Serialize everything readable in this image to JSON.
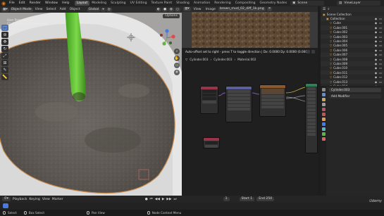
{
  "topbar": {
    "menus": [
      "File",
      "Edit",
      "Render",
      "Window",
      "Help"
    ],
    "workspaces": [
      "Layout",
      "Modeling",
      "Sculpting",
      "UV Editing",
      "Texture Paint",
      "Shading",
      "Animation",
      "Rendering",
      "Compositing",
      "Geometry Nodes",
      "Scripting"
    ],
    "active_workspace": "Layout",
    "scene_label": "Scene",
    "view_layer_label": "ViewLayer"
  },
  "viewport": {
    "mode": "Object Mode",
    "menus": [
      "View",
      "Select",
      "Add",
      "Object"
    ],
    "transform": "Global",
    "options_label": "Options",
    "info_line1": "User Perspective",
    "info_line2": "(1) Collection | Cylinder.003",
    "tools": [
      "select",
      "cursor",
      "move",
      "rotate",
      "scale",
      "transform",
      "annotate",
      "measure"
    ],
    "colors": {
      "soil": "#5f5a55",
      "pot_rim": "#e2e2e2",
      "stem": "#5fbd2c",
      "rim_edge": "#c88a4a",
      "background": "#9a9a98"
    }
  },
  "image_editor": {
    "menus": [
      "View",
      "Image"
    ],
    "image_name": "brown_mud_02_diff_1k.png",
    "colors": {
      "texture": "#5a4632"
    }
  },
  "node_editor": {
    "status_message": "Auto-offset set to right - press T to toggle direction | Dx: 0.0000 Dy: 0.0000 (0.0000)",
    "breadcrumb": [
      "Cylinder.003",
      "Cylinder.003",
      "Material.002"
    ],
    "colors": {
      "tex_coord_header": "#9b3448",
      "mapping_header": "#5b5f9e",
      "image_tex_header": "#8a5a2e",
      "bsdf_header": "#2e8059",
      "output_header": "#9b3448",
      "link": "#7c7c7c"
    }
  },
  "outliner": {
    "title": "Scene Collection",
    "rows": [
      {
        "name": "Collection",
        "depth": 1
      },
      {
        "name": "Cube",
        "depth": 2
      },
      {
        "name": "Cube.001",
        "depth": 2
      },
      {
        "name": "Cube.002",
        "depth": 2
      },
      {
        "name": "Cube.003",
        "depth": 2
      },
      {
        "name": "Cube.004",
        "depth": 2
      },
      {
        "name": "Cube.005",
        "depth": 2
      },
      {
        "name": "Cube.006",
        "depth": 2
      },
      {
        "name": "Cube.007",
        "depth": 2
      },
      {
        "name": "Cube.008",
        "depth": 2
      },
      {
        "name": "Cube.009",
        "depth": 2
      },
      {
        "name": "Cube.010",
        "depth": 2
      },
      {
        "name": "Cube.011",
        "depth": 2
      },
      {
        "name": "Cube.012",
        "depth": 2
      },
      {
        "name": "Cube.013",
        "depth": 2
      },
      {
        "name": "Cube.014",
        "depth": 2
      }
    ]
  },
  "properties": {
    "object_name": "Cylinder.003",
    "add_modifier": "Add Modifier"
  },
  "timeline": {
    "menus": [
      "Playback",
      "Keying",
      "View",
      "Marker"
    ],
    "current_frame": "1",
    "start_label": "Start",
    "start_value": "1",
    "end_label": "End",
    "end_value": "250"
  },
  "statusbar": {
    "items": [
      "Select",
      "Box Select",
      "Pan View",
      "Node Context Menu"
    ]
  },
  "watermark": "Udemy"
}
